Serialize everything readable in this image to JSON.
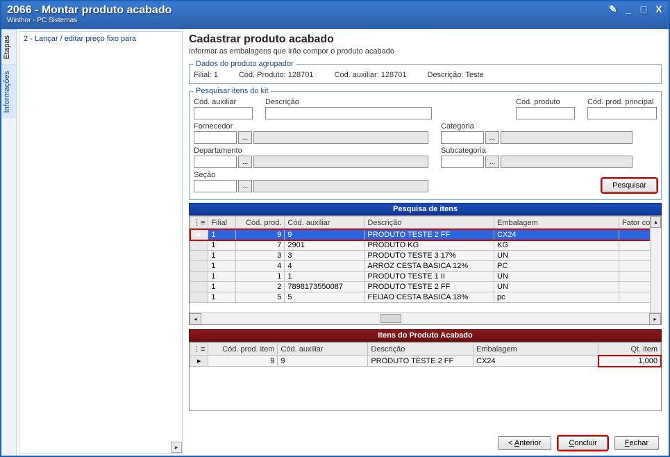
{
  "window": {
    "title": "2066 - Montar produto acabado",
    "subtitle": "Winthor - PC Sistemas",
    "controls": {
      "edit": "✎",
      "min": "_",
      "max": "□",
      "close": "X"
    }
  },
  "vtabs": {
    "etapas": "Etapas",
    "informacoes": "Informações"
  },
  "tree": {
    "item1": "2 - Lançar / editar preço fixo para"
  },
  "main": {
    "heading": "Cadastrar produto acabado",
    "subheading": "Informar as embalagens que irão compor o produto acabado"
  },
  "agrupador": {
    "legend": "Dados do produto agrupador",
    "filial_lbl": "Filial:",
    "filial_val": "1",
    "codprod_lbl": "Cód. Produto:",
    "codprod_val": "128701",
    "codaux_lbl": "Cód. auxiliar:",
    "codaux_val": "128701",
    "desc_lbl": "Descrição:",
    "desc_val": "Teste"
  },
  "search": {
    "legend": "Pesquisar itens do kit",
    "codauxiliar": "Cód. auxiliar",
    "descricao": "Descrição",
    "codproduto": "Cód. produto",
    "codprodprincipal": "Cód. prod. principal",
    "fornecedor": "Fornecedor",
    "categoria": "Categoria",
    "departamento": "Departamento",
    "subcategoria": "Subcategoria",
    "secao": "Seção",
    "pesquisar_btn": "Pesquisar",
    "ellipsis": "..."
  },
  "grid1": {
    "title": "Pesquisa de itens",
    "headers": {
      "filial": "Filial",
      "codprod": "Cód. prod.",
      "codaux": "Cód. auxiliar",
      "desc": "Descrição",
      "emb": "Embalagem",
      "fator": "Fator cor"
    },
    "rows": [
      {
        "filial": "1",
        "codprod": "9",
        "codaux": "9",
        "desc": "PRODUTO TESTE 2 FF",
        "emb": "CX24"
      },
      {
        "filial": "1",
        "codprod": "7",
        "codaux": "2901",
        "desc": "PRODUTO KG",
        "emb": "KG"
      },
      {
        "filial": "1",
        "codprod": "3",
        "codaux": "3",
        "desc": "PRODUTO TESTE 3 17%",
        "emb": "UN"
      },
      {
        "filial": "1",
        "codprod": "4",
        "codaux": "4",
        "desc": "ARROZ CESTA BASICA 12%",
        "emb": "PC"
      },
      {
        "filial": "1",
        "codprod": "1",
        "codaux": "1",
        "desc": "PRODUTO TESTE 1 II",
        "emb": "UN"
      },
      {
        "filial": "1",
        "codprod": "2",
        "codaux": "7898173550087",
        "desc": "PRODUTO TESTE 2 FF",
        "emb": "UN"
      },
      {
        "filial": "1",
        "codprod": "5",
        "codaux": "5",
        "desc": "FEIJAO CESTA BASICA 18%",
        "emb": "pc"
      }
    ]
  },
  "grid2": {
    "title": "Itens do Produto Acabado",
    "headers": {
      "codproditem": "Cód. prod. item",
      "codaux": "Cód. auxiliar",
      "desc": "Descrição",
      "emb": "Embalagem",
      "qtitem": "Qt. item"
    },
    "rows": [
      {
        "codproditem": "9",
        "codaux": "9",
        "desc": "PRODUTO TESTE 2 FF",
        "emb": "CX24",
        "qtitem": "1,000"
      }
    ]
  },
  "footer": {
    "anterior": "Anterior",
    "anterior_prefix": "< ",
    "concluir": "Concluir",
    "fechar": "Fechar",
    "concluir_u": "C",
    "fechar_u": "F",
    "anterior_u": "A"
  }
}
